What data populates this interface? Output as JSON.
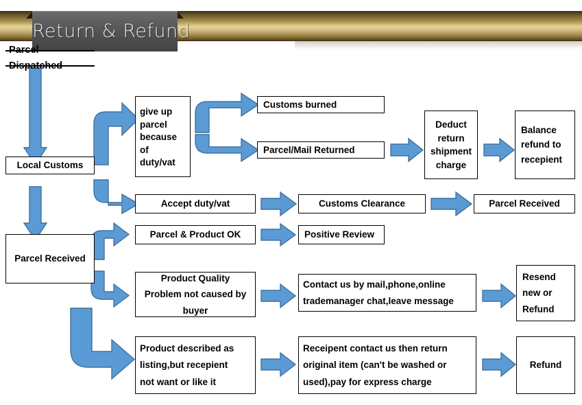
{
  "banner": {
    "title": "Return & Refund",
    "bar_color": "#c9ae63",
    "plate_color": "#565656"
  },
  "theme": {
    "arrow_fill": "#5b9bd5",
    "arrow_stroke": "#41719c",
    "box_border": "#000000",
    "box_fill": "#ffffff",
    "text_color": "#000000"
  },
  "chart_data": {
    "type": "diagram",
    "title": "Return & Refund",
    "nodes": [
      {
        "id": "parcel-dispatched",
        "label": "Parcel Dispatched"
      },
      {
        "id": "local-customs",
        "label": "Local Customs"
      },
      {
        "id": "parcel-received-left",
        "label": "Parcel Received"
      },
      {
        "id": "give-up-parcel",
        "label": "give up parcel because of duty/vat"
      },
      {
        "id": "customs-burned",
        "label": "Customs burned"
      },
      {
        "id": "parcel-mail-returned",
        "label": "Parcel/Mail Returned"
      },
      {
        "id": "deduct-return",
        "label": "Deduct return shipment charge"
      },
      {
        "id": "balance-refund",
        "label": "Balance refund to recepient"
      },
      {
        "id": "accept-duty",
        "label": "Accept duty/vat"
      },
      {
        "id": "customs-clearance",
        "label": "Customs Clearance"
      },
      {
        "id": "parcel-received-top",
        "label": "Parcel Received"
      },
      {
        "id": "parcel-product-ok",
        "label": "Parcel & Product OK"
      },
      {
        "id": "positive-review",
        "label": "Positive Review"
      },
      {
        "id": "product-quality",
        "label": "Product Quality Problem not caused by buyer"
      },
      {
        "id": "contact-us",
        "label": "Contact us by mail,phone,online trademanager chat,leave message"
      },
      {
        "id": "resend-or-refund",
        "label": "Resend new or Refund"
      },
      {
        "id": "product-described",
        "label": "Product described as listing,but recepient not want or like it"
      },
      {
        "id": "recepient-return",
        "label": "Receipent contact us then return original item (can't be washed or used),pay for express charge"
      },
      {
        "id": "refund",
        "label": "Refund"
      }
    ],
    "edges": [
      {
        "from": "parcel-dispatched",
        "to": "local-customs",
        "style": "straight-down"
      },
      {
        "from": "local-customs",
        "to": "give-up-parcel",
        "style": "elbow-up-right"
      },
      {
        "from": "local-customs",
        "to": "accept-duty",
        "style": "elbow-down-right"
      },
      {
        "from": "local-customs",
        "to": "parcel-received-left",
        "style": "straight-down"
      },
      {
        "from": "give-up-parcel",
        "to": "customs-burned",
        "style": "split-elbow-up"
      },
      {
        "from": "give-up-parcel",
        "to": "parcel-mail-returned",
        "style": "split-elbow-down"
      },
      {
        "from": "parcel-mail-returned",
        "to": "deduct-return",
        "style": "straight-right"
      },
      {
        "from": "deduct-return",
        "to": "balance-refund",
        "style": "straight-right"
      },
      {
        "from": "accept-duty",
        "to": "customs-clearance",
        "style": "straight-right"
      },
      {
        "from": "customs-clearance",
        "to": "parcel-received-top",
        "style": "straight-right"
      },
      {
        "from": "parcel-received-left",
        "to": "parcel-product-ok",
        "style": "elbow-up-right"
      },
      {
        "from": "parcel-product-ok",
        "to": "positive-review",
        "style": "straight-right"
      },
      {
        "from": "parcel-received-left",
        "to": "product-quality",
        "style": "elbow-down-right"
      },
      {
        "from": "product-quality",
        "to": "contact-us",
        "style": "straight-right"
      },
      {
        "from": "contact-us",
        "to": "resend-or-refund",
        "style": "straight-right"
      },
      {
        "from": "parcel-received-left",
        "to": "product-described",
        "style": "elbow-long-down-right"
      },
      {
        "from": "product-described",
        "to": "recepient-return",
        "style": "straight-right"
      },
      {
        "from": "recepient-return",
        "to": "refund",
        "style": "straight-right"
      }
    ]
  },
  "nodes": {
    "parcel_dispatched": "Parcel Dispatched",
    "local_customs": "Local Customs",
    "parcel_received_left": "Parcel Received",
    "give_up_parcel_l1": "give up",
    "give_up_parcel_l2": "parcel",
    "give_up_parcel_l3": "because",
    "give_up_parcel_l4": "of",
    "give_up_parcel_l5": "duty/vat",
    "customs_burned": "Customs burned",
    "parcel_mail_returned": "Parcel/Mail Returned",
    "deduct_return_l1": "Deduct",
    "deduct_return_l2": "return",
    "deduct_return_l3": "shipment",
    "deduct_return_l4": "charge",
    "balance_refund_l1": "Balance",
    "balance_refund_l2": "refund to",
    "balance_refund_l3": "recepient",
    "accept_duty": "Accept duty/vat",
    "customs_clearance": "Customs Clearance",
    "parcel_received_top": "Parcel Received",
    "parcel_product_ok": "Parcel & Product OK",
    "positive_review": "Positive Review",
    "product_quality_l1": "Product Quality",
    "product_quality_l2": "Problem not caused by",
    "product_quality_l3": "buyer",
    "contact_us_l1": "Contact us by mail,phone,online",
    "contact_us_l2": "trademanager chat,leave message",
    "resend_refund_l1": "Resend",
    "resend_refund_l2": "new or",
    "resend_refund_l3": "Refund",
    "product_described_l1": "Product described as",
    "product_described_l2": "listing,but recepient",
    "product_described_l3": "not want or like it",
    "recepient_return_l1": "Receipent contact us then return",
    "recepient_return_l2": "original item (can't be washed or",
    "recepient_return_l3": "used),pay for express charge",
    "refund": "Refund"
  }
}
